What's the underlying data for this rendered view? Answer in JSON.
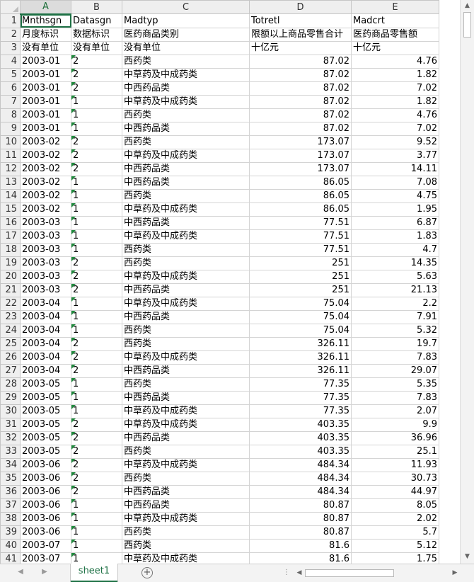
{
  "columns": [
    "A",
    "B",
    "C",
    "D",
    "E"
  ],
  "active_column": "A",
  "rows": [
    {
      "n": "1",
      "a": "Mnthsgn",
      "b": "Datasgn",
      "c": "Madtyp",
      "d": "Totretl",
      "e": "Madcrt",
      "flag": false
    },
    {
      "n": "2",
      "a": "月度标识",
      "b": "数据标识",
      "c": "医药商品类别",
      "d": "限额以上商品零售合计",
      "e": "医药商品零售额",
      "flag": false
    },
    {
      "n": "3",
      "a": "没有单位",
      "b": "没有单位",
      "c": "没有单位",
      "d": "十亿元",
      "e": "十亿元",
      "flag": false
    },
    {
      "n": "4",
      "a": "2003-01",
      "b": "2",
      "c": "西药类",
      "d": "87.02",
      "e": "4.76",
      "flag": true
    },
    {
      "n": "5",
      "a": "2003-01",
      "b": "2",
      "c": "中草药及中成药类",
      "d": "87.02",
      "e": "1.82",
      "flag": true
    },
    {
      "n": "6",
      "a": "2003-01",
      "b": "2",
      "c": "中西药品类",
      "d": "87.02",
      "e": "7.02",
      "flag": true
    },
    {
      "n": "7",
      "a": "2003-01",
      "b": "1",
      "c": "中草药及中成药类",
      "d": "87.02",
      "e": "1.82",
      "flag": true
    },
    {
      "n": "8",
      "a": "2003-01",
      "b": "1",
      "c": "西药类",
      "d": "87.02",
      "e": "4.76",
      "flag": true
    },
    {
      "n": "9",
      "a": "2003-01",
      "b": "1",
      "c": "中西药品类",
      "d": "87.02",
      "e": "7.02",
      "flag": true
    },
    {
      "n": "10",
      "a": "2003-02",
      "b": "2",
      "c": "西药类",
      "d": "173.07",
      "e": "9.52",
      "flag": true
    },
    {
      "n": "11",
      "a": "2003-02",
      "b": "2",
      "c": "中草药及中成药类",
      "d": "173.07",
      "e": "3.77",
      "flag": true
    },
    {
      "n": "12",
      "a": "2003-02",
      "b": "2",
      "c": "中西药品类",
      "d": "173.07",
      "e": "14.11",
      "flag": true
    },
    {
      "n": "13",
      "a": "2003-02",
      "b": "1",
      "c": "中西药品类",
      "d": "86.05",
      "e": "7.08",
      "flag": true
    },
    {
      "n": "14",
      "a": "2003-02",
      "b": "1",
      "c": "西药类",
      "d": "86.05",
      "e": "4.75",
      "flag": true
    },
    {
      "n": "15",
      "a": "2003-02",
      "b": "1",
      "c": "中草药及中成药类",
      "d": "86.05",
      "e": "1.95",
      "flag": true
    },
    {
      "n": "16",
      "a": "2003-03",
      "b": "1",
      "c": "中西药品类",
      "d": "77.51",
      "e": "6.87",
      "flag": true
    },
    {
      "n": "17",
      "a": "2003-03",
      "b": "1",
      "c": "中草药及中成药类",
      "d": "77.51",
      "e": "1.83",
      "flag": true
    },
    {
      "n": "18",
      "a": "2003-03",
      "b": "1",
      "c": "西药类",
      "d": "77.51",
      "e": "4.7",
      "flag": true
    },
    {
      "n": "19",
      "a": "2003-03",
      "b": "2",
      "c": "西药类",
      "d": "251",
      "e": "14.35",
      "flag": true
    },
    {
      "n": "20",
      "a": "2003-03",
      "b": "2",
      "c": "中草药及中成药类",
      "d": "251",
      "e": "5.63",
      "flag": true
    },
    {
      "n": "21",
      "a": "2003-03",
      "b": "2",
      "c": "中西药品类",
      "d": "251",
      "e": "21.13",
      "flag": true
    },
    {
      "n": "22",
      "a": "2003-04",
      "b": "1",
      "c": "中草药及中成药类",
      "d": "75.04",
      "e": "2.2",
      "flag": true
    },
    {
      "n": "23",
      "a": "2003-04",
      "b": "1",
      "c": "中西药品类",
      "d": "75.04",
      "e": "7.91",
      "flag": true
    },
    {
      "n": "24",
      "a": "2003-04",
      "b": "1",
      "c": "西药类",
      "d": "75.04",
      "e": "5.32",
      "flag": true
    },
    {
      "n": "25",
      "a": "2003-04",
      "b": "2",
      "c": "西药类",
      "d": "326.11",
      "e": "19.7",
      "flag": true
    },
    {
      "n": "26",
      "a": "2003-04",
      "b": "2",
      "c": "中草药及中成药类",
      "d": "326.11",
      "e": "7.83",
      "flag": true
    },
    {
      "n": "27",
      "a": "2003-04",
      "b": "2",
      "c": "中西药品类",
      "d": "326.11",
      "e": "29.07",
      "flag": true
    },
    {
      "n": "28",
      "a": "2003-05",
      "b": "1",
      "c": "西药类",
      "d": "77.35",
      "e": "5.35",
      "flag": true
    },
    {
      "n": "29",
      "a": "2003-05",
      "b": "1",
      "c": "中西药品类",
      "d": "77.35",
      "e": "7.83",
      "flag": true
    },
    {
      "n": "30",
      "a": "2003-05",
      "b": "1",
      "c": "中草药及中成药类",
      "d": "77.35",
      "e": "2.07",
      "flag": true
    },
    {
      "n": "31",
      "a": "2003-05",
      "b": "2",
      "c": "中草药及中成药类",
      "d": "403.35",
      "e": "9.9",
      "flag": true
    },
    {
      "n": "32",
      "a": "2003-05",
      "b": "2",
      "c": "中西药品类",
      "d": "403.35",
      "e": "36.96",
      "flag": true
    },
    {
      "n": "33",
      "a": "2003-05",
      "b": "2",
      "c": "西药类",
      "d": "403.35",
      "e": "25.1",
      "flag": true
    },
    {
      "n": "34",
      "a": "2003-06",
      "b": "2",
      "c": "中草药及中成药类",
      "d": "484.34",
      "e": "11.93",
      "flag": true
    },
    {
      "n": "35",
      "a": "2003-06",
      "b": "2",
      "c": "西药类",
      "d": "484.34",
      "e": "30.73",
      "flag": true
    },
    {
      "n": "36",
      "a": "2003-06",
      "b": "2",
      "c": "中西药品类",
      "d": "484.34",
      "e": "44.97",
      "flag": true
    },
    {
      "n": "37",
      "a": "2003-06",
      "b": "1",
      "c": "中西药品类",
      "d": "80.87",
      "e": "8.05",
      "flag": true
    },
    {
      "n": "38",
      "a": "2003-06",
      "b": "1",
      "c": "中草药及中成药类",
      "d": "80.87",
      "e": "2.02",
      "flag": true
    },
    {
      "n": "39",
      "a": "2003-06",
      "b": "1",
      "c": "西药类",
      "d": "80.87",
      "e": "5.7",
      "flag": true
    },
    {
      "n": "40",
      "a": "2003-07",
      "b": "1",
      "c": "西药类",
      "d": "81.6",
      "e": "5.12",
      "flag": true
    },
    {
      "n": "41",
      "a": "2003-07",
      "b": "1",
      "c": "中草药及中成药类",
      "d": "81.6",
      "e": "1.75",
      "flag": true
    }
  ],
  "sheet_tab": "sheet1",
  "add_sheet_symbol": "⊕",
  "icons": {
    "vscroll_up": "chevron-up-icon",
    "vscroll_down": "chevron-down-icon",
    "tab_prev": "chevron-left-icon",
    "tab_next": "chevron-right-icon",
    "add_sheet": "plus-circle-icon"
  },
  "colors": {
    "accent": "#1e7145",
    "number_indicator": "#1e8a3c"
  }
}
